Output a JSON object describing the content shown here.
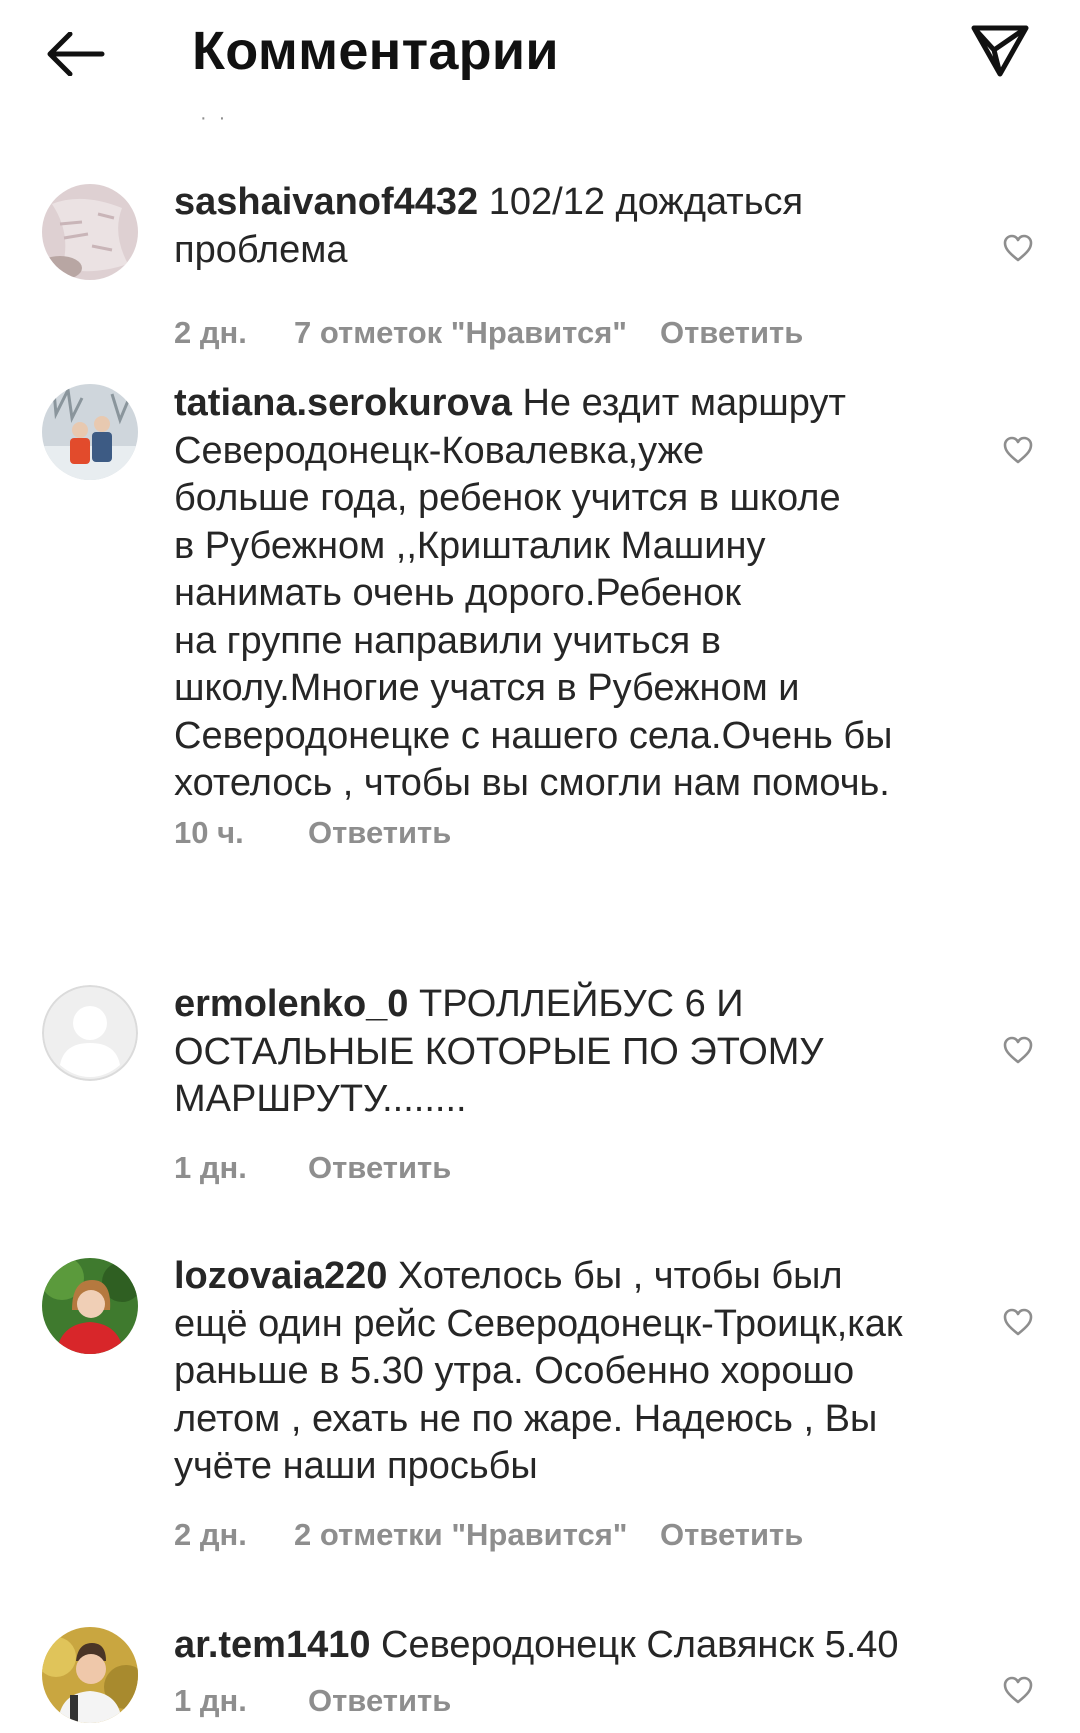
{
  "header": {
    "title": "Комментарии",
    "back_icon": "arrow-left-icon",
    "share_icon": "paper-plane-icon"
  },
  "comments": [
    {
      "username": "sashaivanof4432",
      "text": " 102/12 дождаться\nпроблема",
      "time": "2 дн.",
      "likes": "7 отметок \"Нравится\"",
      "reply": "Ответить",
      "avatar": "photo-avatar"
    },
    {
      "username": "tatiana.serokurova",
      "text": " Не ездит маршрут\nСеверодонецк-Ковалевка,уже\nбольше года, ребенок учится в школе\nв Рубежном ,,Кришталик Машину\nнанимать очень дорого.Ребенок\nна группе направили учиться в\nшколу.Многие  учатся в Рубежном и\nСеверодонецке с нашего села.Очень бы\nхотелось , чтобы вы смогли нам помочь.",
      "time": "10 ч.",
      "reply": "Ответить",
      "avatar": "photo-avatar"
    },
    {
      "username": "ermolenko_0",
      "text": " ТРОЛЛЕЙБУС 6 И\nОСТАЛЬНЫЕ КОТОРЫЕ ПО ЭТОМУ\nМАРШРУТУ........",
      "time": "1 дн.",
      "reply": "Ответить",
      "avatar": "default-user-icon"
    },
    {
      "username": "lozovaia220",
      "text": " Хотелось бы , чтобы был\nещё один рейс Северодонецк-Троицк,как\nраньше в 5.30 утра. Особенно хорошо\nлетом , ехать не по жаре. Надеюсь , Вы\nучёте наши  просьбы",
      "time": "2 дн.",
      "likes": "2 отметки \"Нравится\"",
      "reply": "Ответить",
      "avatar": "photo-avatar"
    },
    {
      "username": "ar.tem1410",
      "text": " Северодонецк Славянск 5.40",
      "time": "1 дн.",
      "reply": "Ответить",
      "avatar": "photo-avatar"
    }
  ],
  "colors": {
    "text": "#262626",
    "secondary": "#8e8e8e",
    "background": "#ffffff"
  }
}
